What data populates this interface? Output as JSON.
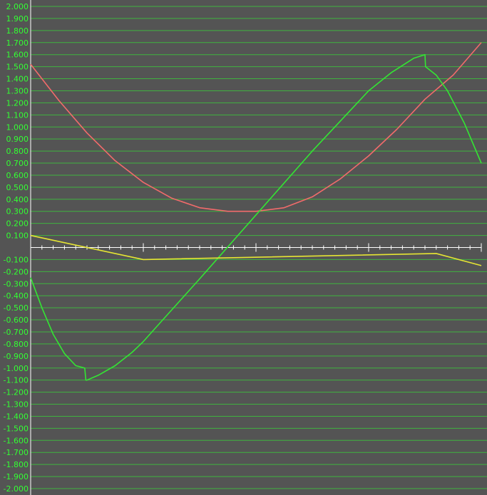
{
  "chart_data": {
    "type": "line",
    "title": "",
    "xlabel": "",
    "ylabel": "",
    "xlim": [
      0,
      4
    ],
    "ylim": [
      -2.0,
      2.0
    ],
    "y_ticks": [
      "2.000",
      "1.900",
      "1.800",
      "1.700",
      "1.600",
      "1.500",
      "1.400",
      "1.300",
      "1.200",
      "1.100",
      "1.000",
      "0.900",
      "0.800",
      "0.700",
      "0.600",
      "0.500",
      "0.400",
      "0.300",
      "0.200",
      "0.100",
      "-0.100",
      "-0.200",
      "-0.300",
      "-0.400",
      "-0.500",
      "-0.600",
      "-0.700",
      "-0.800",
      "-0.900",
      "-1.000",
      "-1.100",
      "-1.200",
      "-1.300",
      "-1.400",
      "-1.500",
      "-1.600",
      "-1.700",
      "-1.800",
      "-1.900",
      "-2.000"
    ],
    "grid": true,
    "colors": {
      "background": "#545454",
      "grid": "#3fb33f",
      "axis": "#ffffff",
      "tick_label": "#33ff33"
    },
    "series": [
      {
        "color": "#f26b6b",
        "x": [
          0,
          0.25,
          0.5,
          0.75,
          1.0,
          1.25,
          1.5,
          1.75,
          2.0,
          2.25,
          2.5,
          2.75,
          3.0,
          3.25,
          3.5,
          3.75,
          4.0
        ],
        "y": [
          1.52,
          1.22,
          0.95,
          0.72,
          0.54,
          0.41,
          0.33,
          0.3,
          0.3,
          0.33,
          0.42,
          0.57,
          0.76,
          0.98,
          1.23,
          1.43,
          1.7
        ]
      },
      {
        "color": "#33e633",
        "x": [
          0,
          0.1,
          0.2,
          0.3,
          0.4,
          0.48,
          0.49,
          0.5,
          0.6,
          0.75,
          0.9,
          1.0,
          1.5,
          2.0,
          2.5,
          3.0,
          3.2,
          3.4,
          3.5,
          3.505,
          3.6,
          3.7,
          3.85,
          4.0
        ],
        "y": [
          -0.25,
          -0.5,
          -0.72,
          -0.88,
          -0.98,
          -1.0,
          -1.1,
          -1.1,
          -1.06,
          -0.98,
          -0.87,
          -0.78,
          -0.26,
          0.27,
          0.8,
          1.3,
          1.45,
          1.57,
          1.6,
          1.5,
          1.43,
          1.3,
          1.03,
          0.7
        ]
      },
      {
        "color": "#e6e633",
        "x": [
          0,
          1.0,
          3.6,
          4.0
        ],
        "y": [
          0.1,
          -0.1,
          -0.05,
          -0.15
        ]
      }
    ]
  }
}
